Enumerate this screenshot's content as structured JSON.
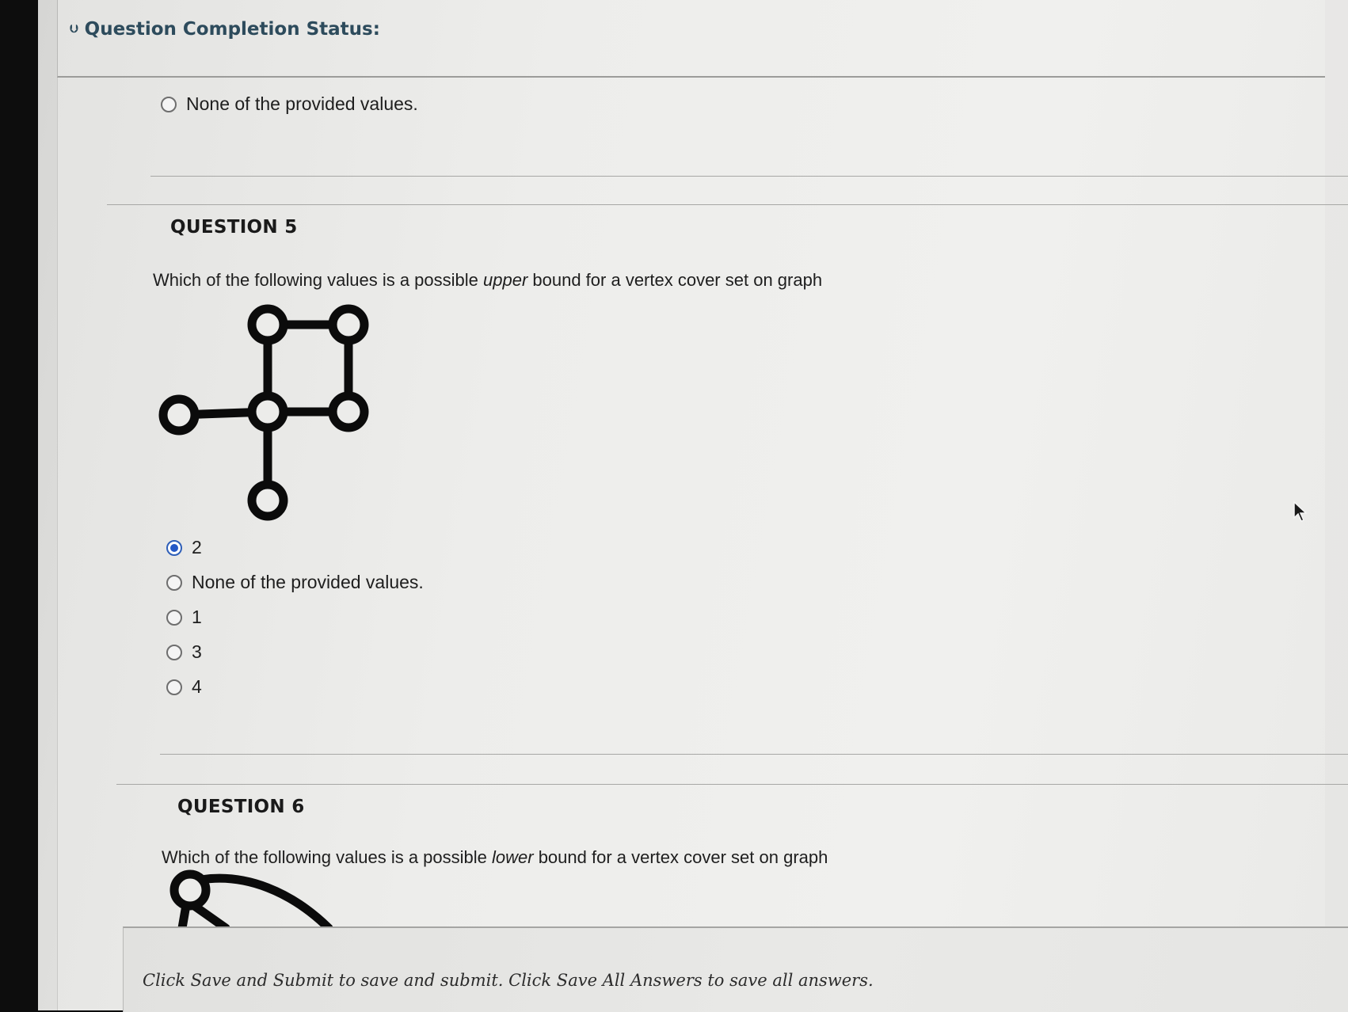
{
  "status": {
    "title": "Question Completion Status:"
  },
  "previous_question": {
    "options": [
      {
        "label": "None of the provided values.",
        "selected": false
      }
    ]
  },
  "question5": {
    "title": "QUESTION 5",
    "text_before": "Which of the following values is a possible ",
    "text_emphasis": "upper",
    "text_after": " bound for a vertex cover set on graph",
    "options": [
      {
        "label": "2",
        "selected": true
      },
      {
        "label": "None of the provided values.",
        "selected": false
      },
      {
        "label": "1",
        "selected": false
      },
      {
        "label": "3",
        "selected": false
      },
      {
        "label": "4",
        "selected": false
      }
    ]
  },
  "question6": {
    "title": "QUESTION 6",
    "text_before": "Which of the following values is a possible ",
    "text_emphasis": "lower",
    "text_after": " bound for a vertex cover set on graph"
  },
  "footer": {
    "instructions": "Click Save and Submit to save and submit. Click Save All Answers to save all answers."
  },
  "colors": {
    "accent": "#2458c6",
    "heading": "#2d4b5c"
  }
}
